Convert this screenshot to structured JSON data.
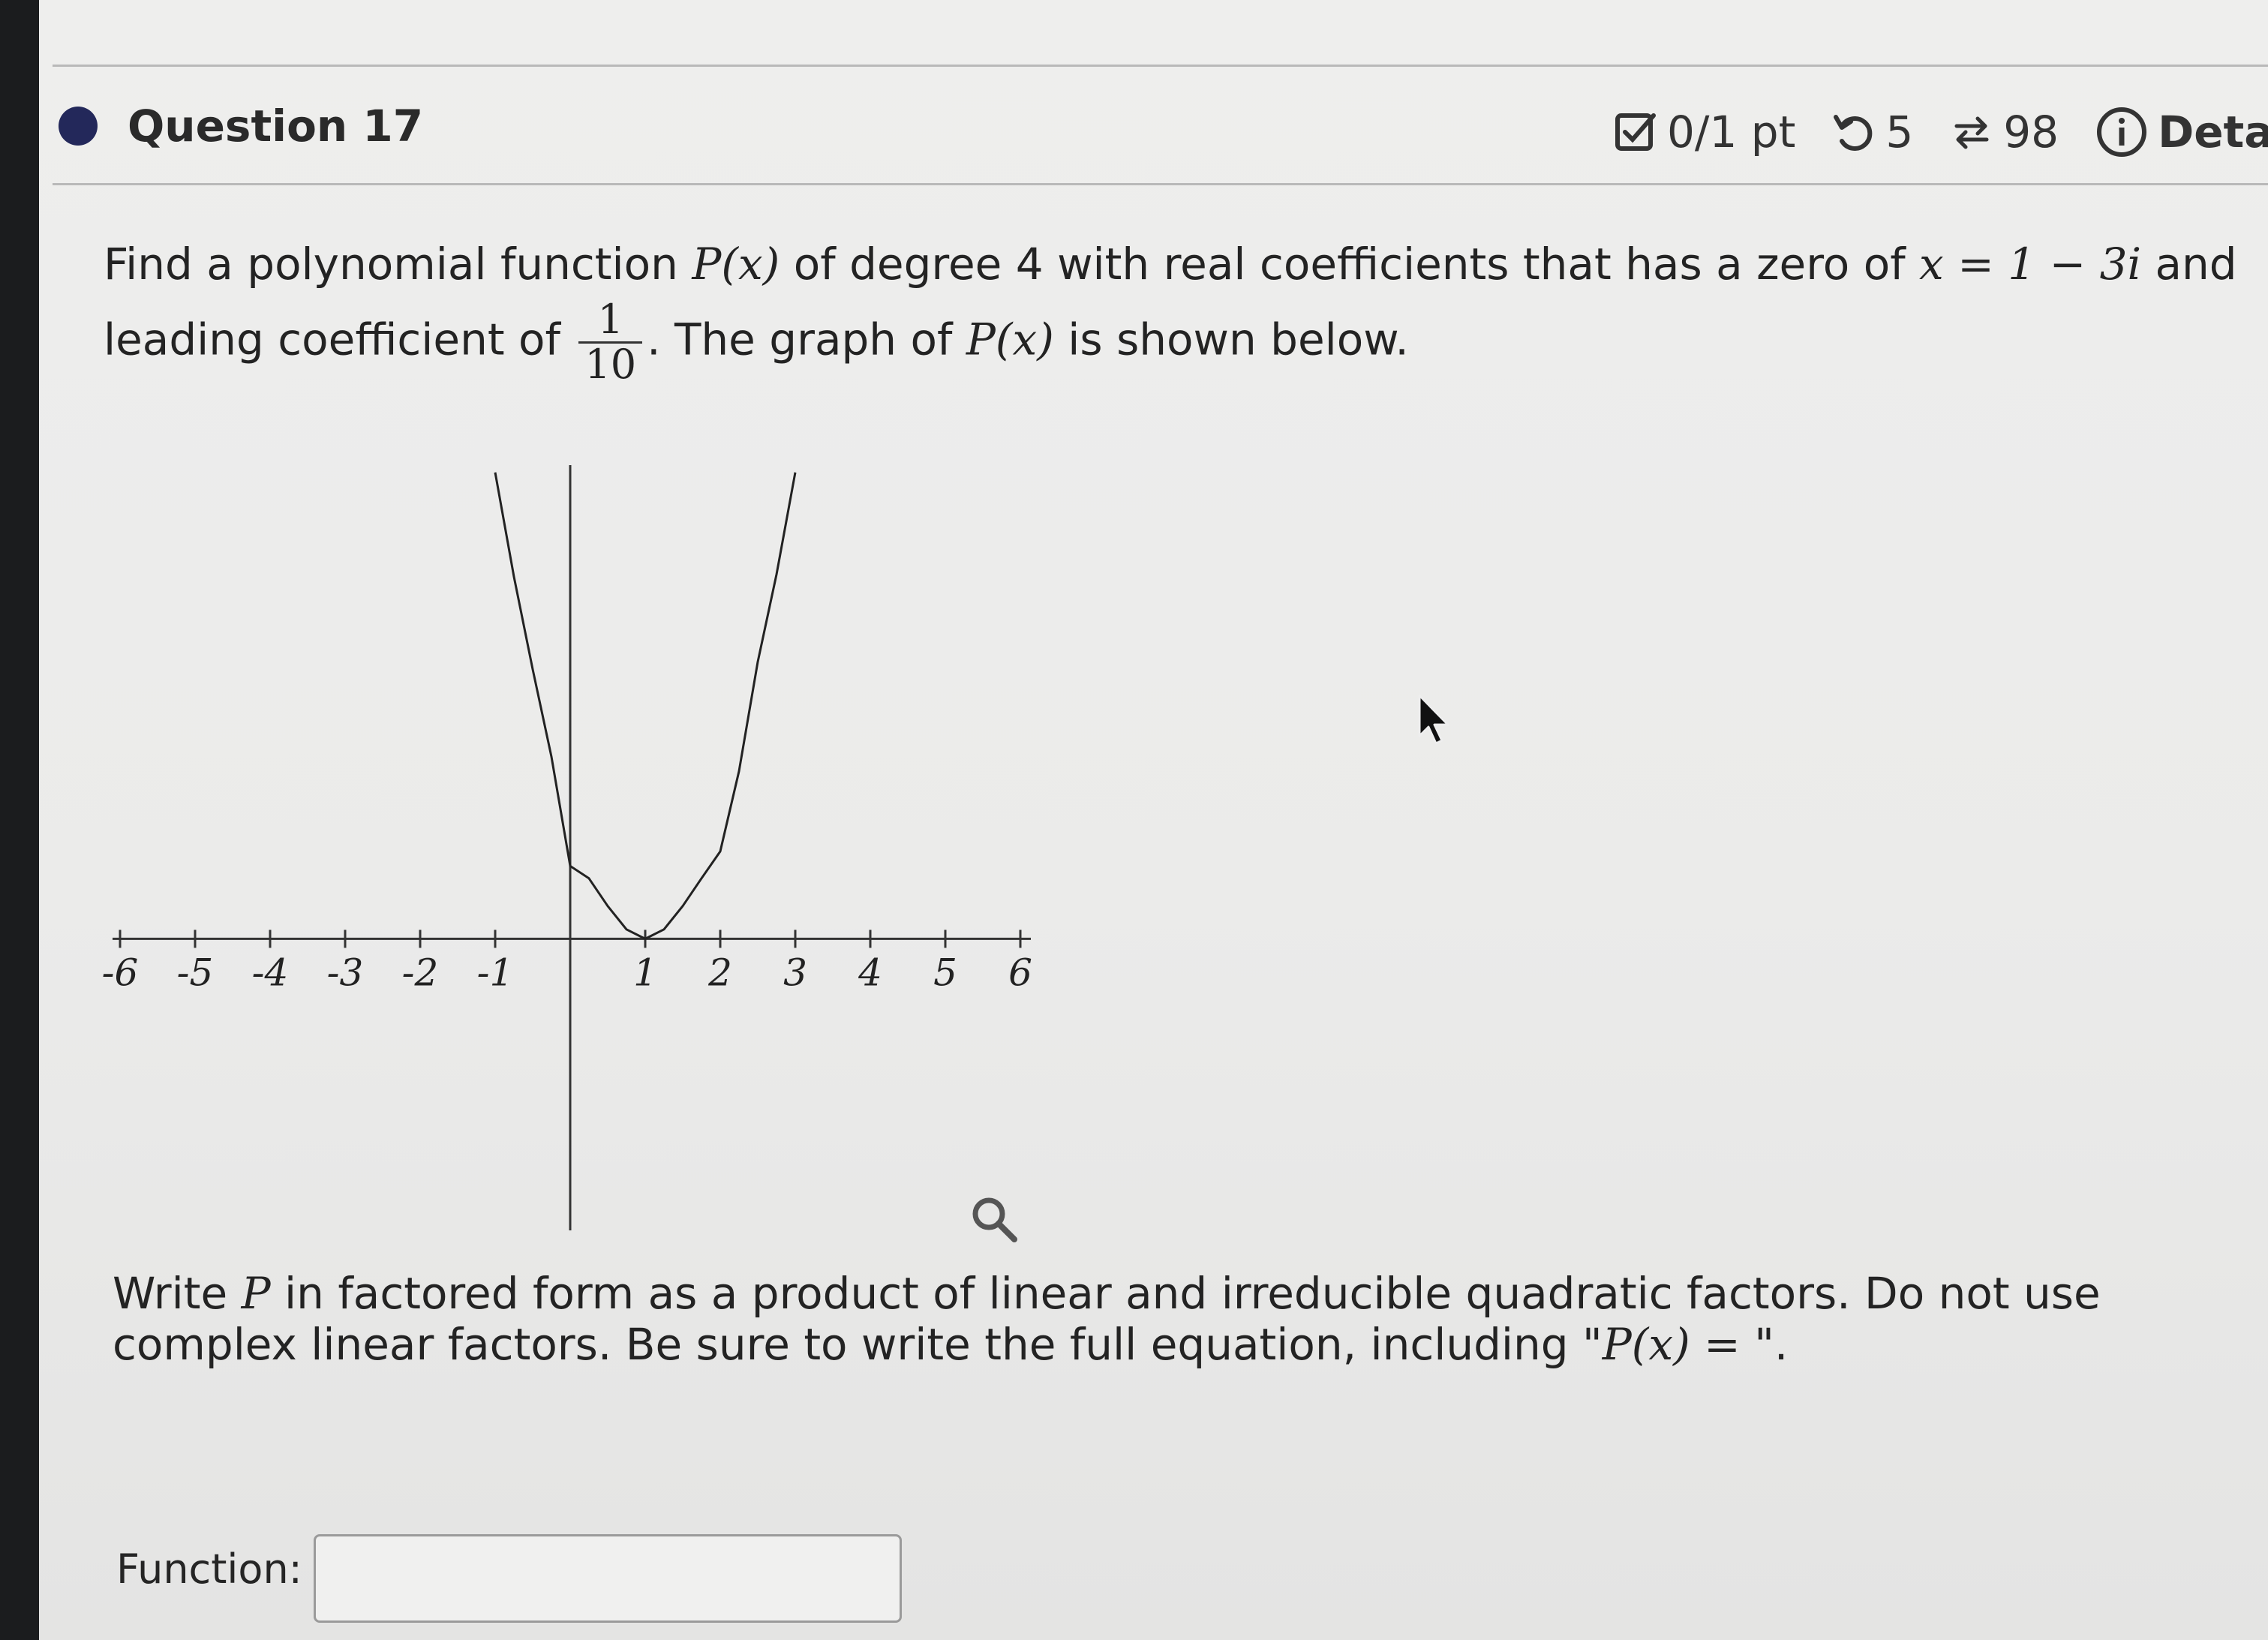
{
  "question": {
    "title": "Question 17"
  },
  "status": {
    "score": "0/1 pt",
    "retries": "5",
    "submissions": "98",
    "details_label": "Deta",
    "icons": [
      "checkbox-icon",
      "retry-icon",
      "submissions-icon",
      "info-icon"
    ]
  },
  "prompt": {
    "line1_a": "Find a polynomial function ",
    "function_name": "P(x)",
    "line1_b": " of degree 4 with real coefficients that has a zero of ",
    "zero_expr": "x = 1 − 3i",
    "line1_c": " and",
    "line2_a": "leading coefficient of ",
    "leading_num": "1",
    "leading_den": "10",
    "line2_b": ". The graph of ",
    "line2_fn": "P(x)",
    "line2_c": " is shown below."
  },
  "chart_data": {
    "type": "line",
    "x_ticks": [
      "-6",
      "-5",
      "-4",
      "-3",
      "-2",
      "-1",
      "1",
      "2",
      "3",
      "4",
      "5",
      "6"
    ],
    "xlim": [
      -6,
      6
    ],
    "ylim": [
      -4,
      6.5
    ],
    "grid": false,
    "series": [
      {
        "x": [
          -1,
          -0.75,
          -0.5,
          -0.25,
          0,
          0.25,
          0.5,
          0.75,
          1,
          1.25,
          1.5,
          1.75,
          2,
          2.25,
          2.5,
          2.75,
          3
        ],
        "y": [
          6.4,
          4.97,
          3.7,
          2.5,
          1.0,
          0.83,
          0.45,
          0.13,
          0.0,
          0.13,
          0.45,
          0.83,
          1.2,
          2.3,
          3.8,
          5.0,
          6.4
        ]
      }
    ]
  },
  "instructions": {
    "text_a": "Write ",
    "var_p": "P",
    "text_b": " in factored form as a product of linear and irreducible quadratic factors. Do not use complex linear factors. Be sure to write the full equation, including \"",
    "eq": "P(x) = ",
    "text_c": "\"."
  },
  "answer": {
    "label": "Function:",
    "value": "",
    "placeholder": ""
  }
}
